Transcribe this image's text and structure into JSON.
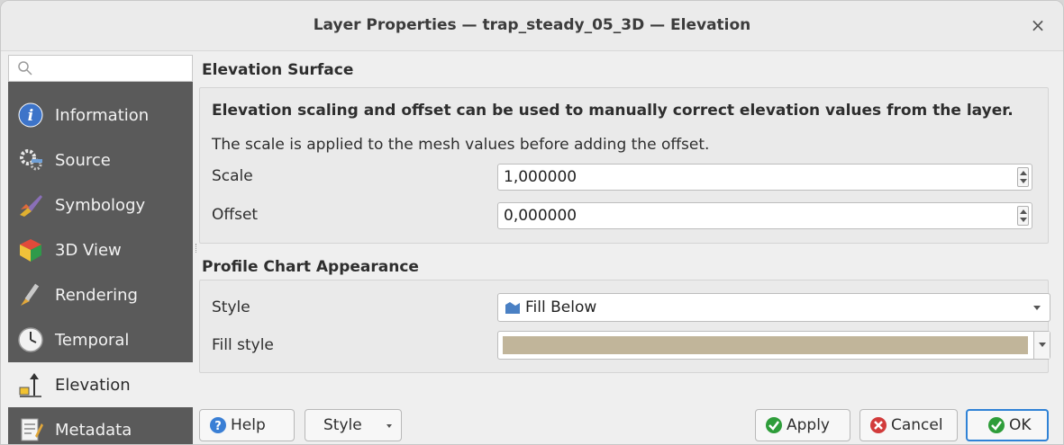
{
  "window": {
    "title": "Layer Properties — trap_steady_05_3D — Elevation",
    "close_glyph": "×"
  },
  "sidebar": {
    "search": {
      "placeholder": "",
      "value": ""
    },
    "items": [
      {
        "label": "Information",
        "icon": "information-icon"
      },
      {
        "label": "Source",
        "icon": "source-icon"
      },
      {
        "label": "Symbology",
        "icon": "symbology-icon"
      },
      {
        "label": "3D View",
        "icon": "3d-view-icon"
      },
      {
        "label": "Rendering",
        "icon": "rendering-icon"
      },
      {
        "label": "Temporal",
        "icon": "temporal-icon"
      },
      {
        "label": "Elevation",
        "icon": "elevation-icon",
        "active": true
      },
      {
        "label": "Metadata",
        "icon": "metadata-icon"
      }
    ]
  },
  "elevation_surface": {
    "title": "Elevation Surface",
    "headline": "Elevation scaling and offset can be used to manually correct elevation values from the layer.",
    "description": "The scale is applied to the mesh values before adding the offset.",
    "scale_label": "Scale",
    "scale_value": "1,000000",
    "offset_label": "Offset",
    "offset_value": "0,000000"
  },
  "profile_chart": {
    "title": "Profile Chart Appearance",
    "style_label": "Style",
    "style_value": "Fill Below",
    "fill_style_label": "Fill style",
    "fill_color": "#c1b59a"
  },
  "buttons": {
    "help": "Help",
    "style": "Style",
    "apply": "Apply",
    "cancel": "Cancel",
    "ok": "OK"
  },
  "colors": {
    "sidebar_bg": "#5a5a5a",
    "ok_border": "#2f82d6",
    "apply_icon": "#2e9d3a",
    "cancel_icon": "#d23b3b",
    "help_icon": "#3a7fd5"
  }
}
